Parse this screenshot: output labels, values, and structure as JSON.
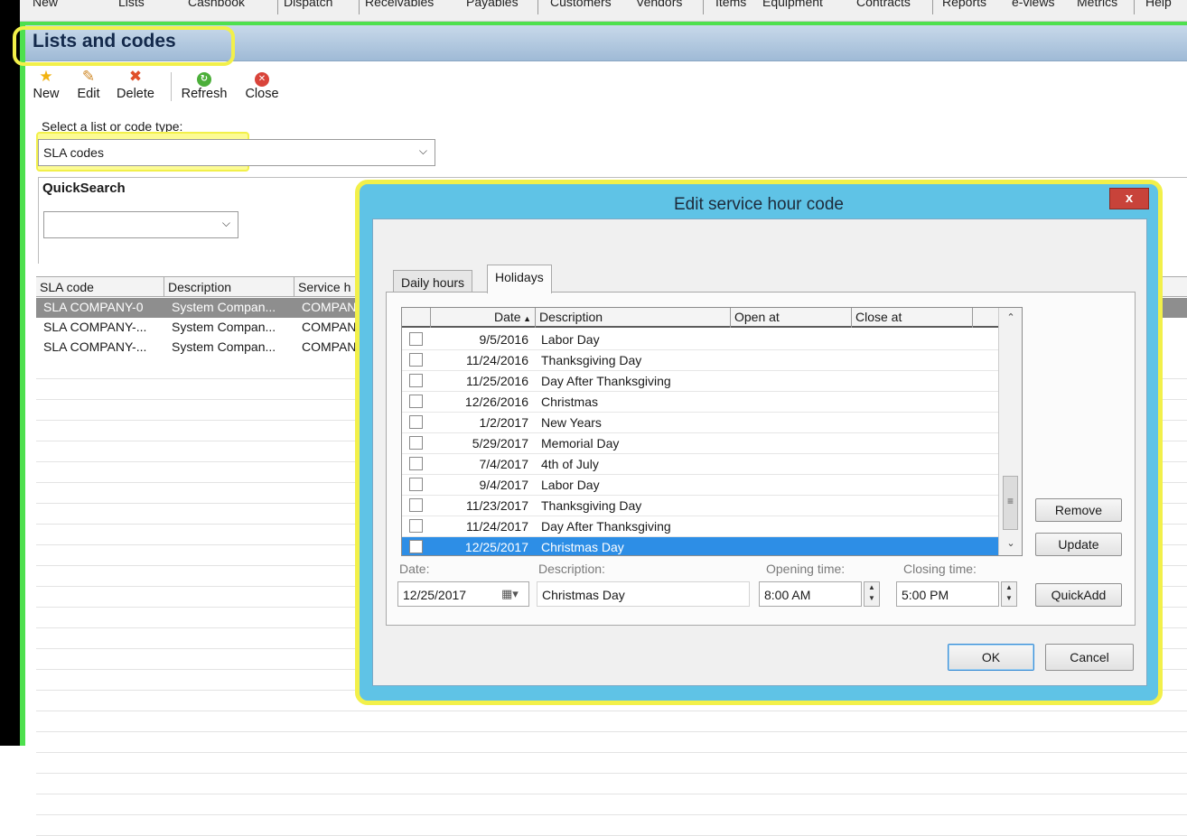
{
  "menubar": {
    "items": [
      "New",
      "Lists",
      "Cashbook",
      "Dispatch",
      "Receivables",
      "Payables",
      "Customers",
      "Vendors",
      "Items",
      "Equipment",
      "Contracts",
      "Reports",
      "e-views",
      "Metrics",
      "Help"
    ]
  },
  "page": {
    "title": "Lists and codes"
  },
  "toolbar": {
    "new_label": "New",
    "edit_label": "Edit",
    "delete_label": "Delete",
    "refresh_label": "Refresh",
    "close_label": "Close"
  },
  "list_selector": {
    "label": "Select a list or code type:",
    "value": "SLA codes"
  },
  "quicksearch": {
    "label": "QuickSearch",
    "value": ""
  },
  "grid": {
    "columns": [
      "SLA code",
      "Description",
      "Service h"
    ],
    "rows": [
      [
        "SLA COMPANY-0",
        "System Compan...",
        "COMPAN"
      ],
      [
        "SLA COMPANY-...",
        "System Compan...",
        "COMPAN"
      ],
      [
        "SLA COMPANY-...",
        "System Compan...",
        "COMPAN"
      ]
    ]
  },
  "dialog": {
    "title": "Edit service hour code",
    "close_label": "x",
    "tabs": [
      "Daily hours",
      "Holidays"
    ],
    "active_tab": "Holidays",
    "holiday_columns": [
      "Date",
      "Description",
      "Open at",
      "Close at"
    ],
    "holidays": [
      {
        "date": "9/5/2016",
        "description": "Labor Day"
      },
      {
        "date": "11/24/2016",
        "description": "Thanksgiving Day"
      },
      {
        "date": "11/25/2016",
        "description": "Day After Thanksgiving"
      },
      {
        "date": "12/26/2016",
        "description": "Christmas"
      },
      {
        "date": "1/2/2017",
        "description": "New Years"
      },
      {
        "date": "5/29/2017",
        "description": "Memorial Day"
      },
      {
        "date": "7/4/2017",
        "description": "4th of July"
      },
      {
        "date": "9/4/2017",
        "description": "Labor Day"
      },
      {
        "date": "11/23/2017",
        "description": "Thanksgiving Day"
      },
      {
        "date": "11/24/2017",
        "description": "Day After Thanksgiving"
      },
      {
        "date": "12/25/2017",
        "description": "Christmas Day"
      }
    ],
    "selected_holiday": "12/25/2017",
    "remove_label": "Remove",
    "update_label": "Update",
    "quickadd_label": "QuickAdd",
    "form": {
      "date_label": "Date:",
      "date_value": "12/25/2017",
      "description_label": "Description:",
      "description_value": "Christmas Day",
      "opening_label": "Opening time:",
      "opening_value": "8:00 AM",
      "closing_label": "Closing time:",
      "closing_value": "5:00 PM"
    },
    "ok_label": "OK",
    "cancel_label": "Cancel"
  },
  "colors": {
    "titlebar": "#9fbad6",
    "dialog_frame": "#5fc3e6",
    "highlight": "#f2f04a",
    "selection": "#2d8ee6",
    "window_edge": "#4ee04e"
  },
  "icons": [
    "star-icon",
    "pencil-icon",
    "delete-x-icon",
    "refresh-icon",
    "close-circle-icon",
    "calendar-icon",
    "sort-up-icon",
    "chevron-down-icon"
  ]
}
